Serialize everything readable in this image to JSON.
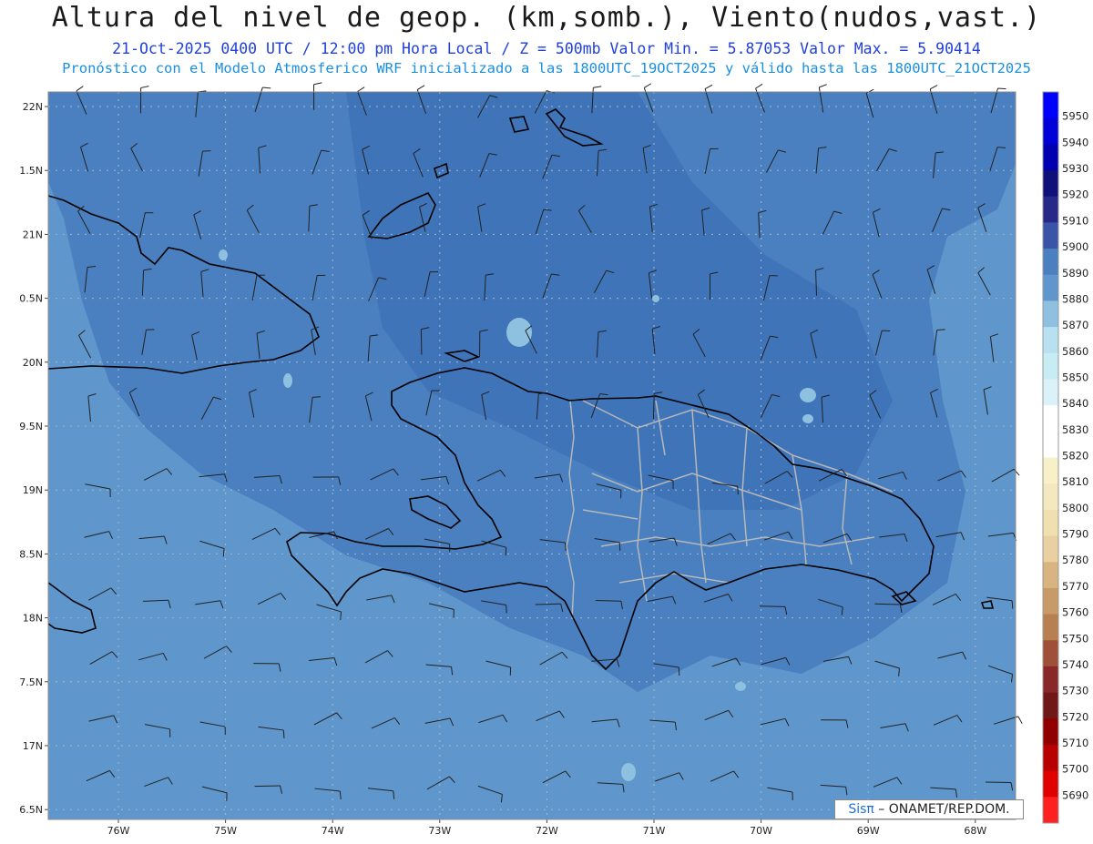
{
  "header": {
    "title": "Altura del nivel de geop. (km,somb.), Viento(nudos,vast.)",
    "subtitle": "21-Oct-2025  0400 UTC / 12:00 pm Hora Local / Z = 500mb    Valor Min. = 5.87053  Valor Max. = 5.90414",
    "model_line": "Pronóstico con el Modelo Atmosferico WRF inicializado a las 1800UTC_19OCT2025 y válido hasta las  1800UTC_21OCT2025"
  },
  "axes": {
    "lat_labels": [
      "22N",
      "1.5N",
      "21N",
      "0.5N",
      "20N",
      "9.5N",
      "19N",
      "8.5N",
      "18N",
      "7.5N",
      "17N",
      "6.5N"
    ],
    "lon_labels": [
      "76W",
      "75W",
      "74W",
      "73W",
      "72W",
      "71W",
      "70W",
      "69W",
      "68W"
    ]
  },
  "colorbar": {
    "labels": [
      "5950",
      "5940",
      "5930",
      "5920",
      "5910",
      "5900",
      "5890",
      "5880",
      "5870",
      "5860",
      "5850",
      "5840",
      "5830",
      "5820",
      "5810",
      "5800",
      "5790",
      "5780",
      "5770",
      "5760",
      "5750",
      "5740",
      "5730",
      "5720",
      "5710",
      "5700",
      "5690"
    ],
    "colors": [
      "#0000ff",
      "#0000d8",
      "#0000b0",
      "#10107a",
      "#282888",
      "#3a55a8",
      "#4a7fc0",
      "#5f97cc",
      "#8ec0e0",
      "#b8e0ee",
      "#c8ecf4",
      "#daf2f8",
      "#ffffff",
      "#ffffff",
      "#f8f0c8",
      "#f4e8c0",
      "#f0e0b0",
      "#e8d0a0",
      "#d8b480",
      "#c89a68",
      "#b88050",
      "#a05038",
      "#882828",
      "#701818",
      "#900000",
      "#b80000",
      "#e00000",
      "#ff2020"
    ]
  },
  "credit": {
    "sis": "Sisπ",
    "rest": " – ONAMET/REP.DOM."
  },
  "colors": {
    "field_main": "#4a7fc0",
    "field_dark": "#3a6db2",
    "field_light": "#5f97cc",
    "field_pale": "#8ec0e0",
    "coast": "#000000",
    "borders": "#b8b8b8",
    "grid": "#a8b8cc"
  }
}
